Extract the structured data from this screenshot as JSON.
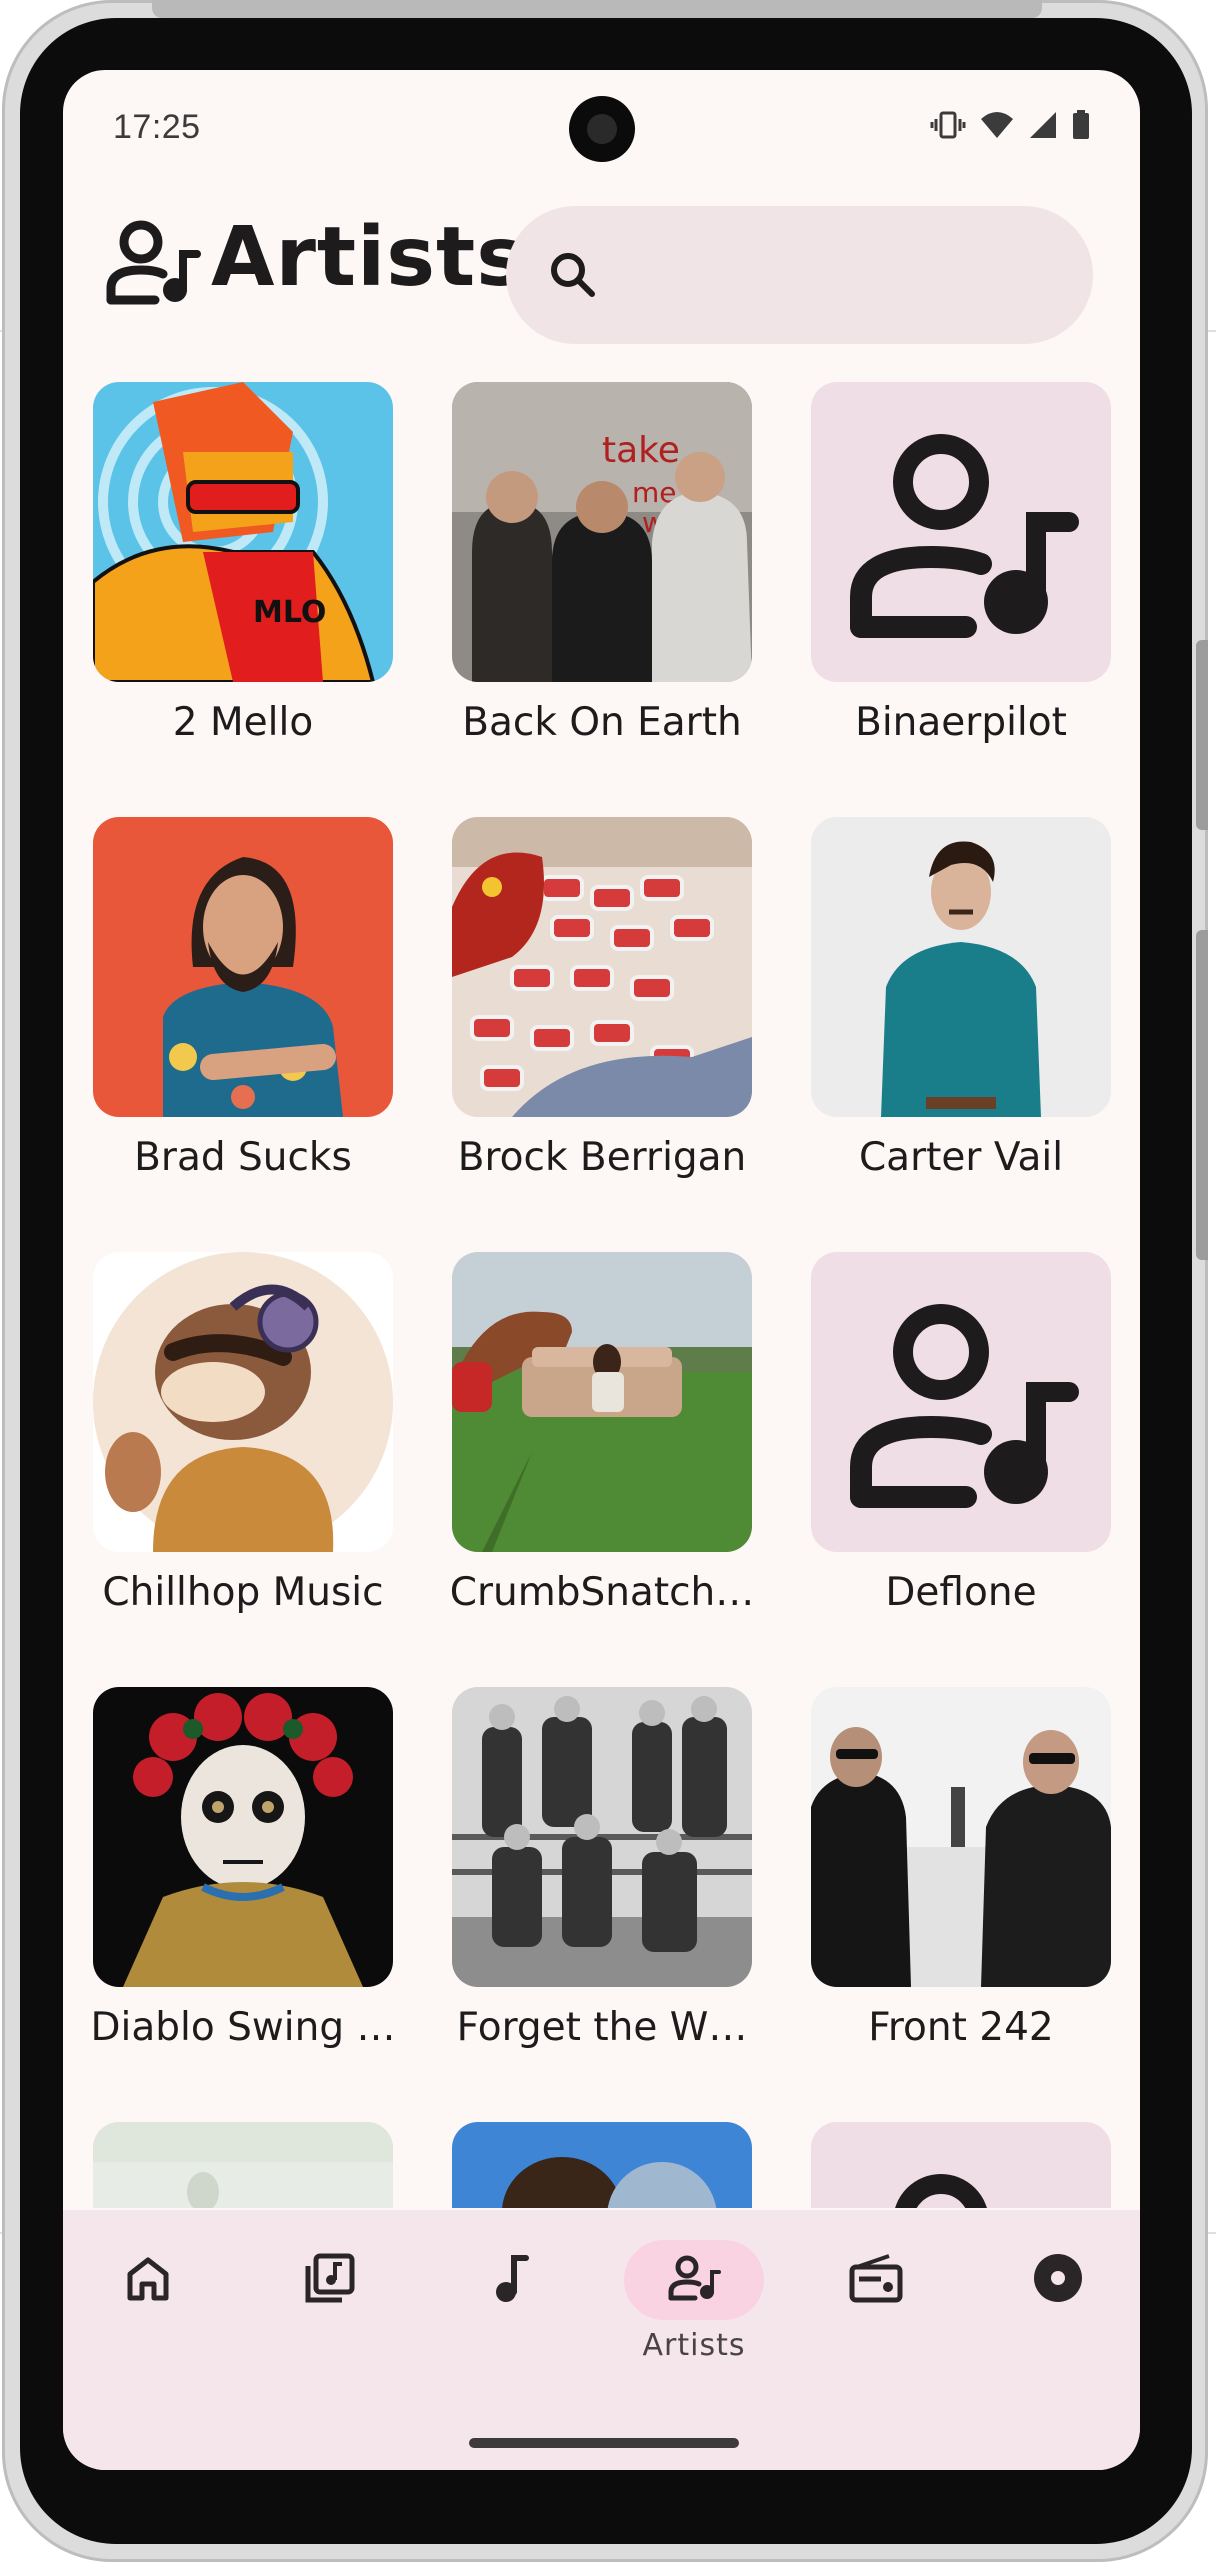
{
  "status_bar": {
    "time": "17:25",
    "icons": [
      "vibrate-icon",
      "wifi-icon",
      "signal-icon",
      "battery-icon"
    ]
  },
  "header": {
    "title": "Artists",
    "title_icon": "artists-icon",
    "search": {
      "placeholder": "",
      "value": "",
      "icon": "search-icon"
    }
  },
  "artists": [
    {
      "name": "2 Mello",
      "image": "illustrated-avatar-orange-hair-headphones"
    },
    {
      "name": "Back On Earth",
      "image": "band-photo-three-men"
    },
    {
      "name": "Binaerpilot",
      "image": "placeholder-artist-icon"
    },
    {
      "name": "Brad Sucks",
      "image": "man-long-hair-floral-shirt"
    },
    {
      "name": "Brock Berrigan",
      "image": "rooster-mask-beer-cans"
    },
    {
      "name": "Carter Vail",
      "image": "man-teal-shirt-white-bg"
    },
    {
      "name": "Chillhop Music",
      "image": "illustrated-raccoon-headphones"
    },
    {
      "name": "CrumbSnatch…",
      "image": "person-on-couch-in-field-horse"
    },
    {
      "name": "Deflone",
      "image": "placeholder-artist-icon"
    },
    {
      "name": "Diablo Swing …",
      "image": "sugar-skull-woman-roses"
    },
    {
      "name": "Forget the W…",
      "image": "band-black-white-fence"
    },
    {
      "name": "Front 242",
      "image": "two-men-sunglasses-beach"
    },
    {
      "name": "",
      "image": "pale-photo"
    },
    {
      "name": "",
      "image": "blue-sky-portrait"
    },
    {
      "name": "",
      "image": "placeholder-artist-icon"
    }
  ],
  "bottom_nav": {
    "items": [
      {
        "icon": "home-icon",
        "label": ""
      },
      {
        "icon": "album-icon",
        "label": ""
      },
      {
        "icon": "music-note-icon",
        "label": ""
      },
      {
        "icon": "artists-icon",
        "label": "Artists",
        "active": true
      },
      {
        "icon": "radio-icon",
        "label": ""
      },
      {
        "icon": "disc-icon",
        "label": ""
      }
    ]
  },
  "colors": {
    "background": "#fdf7f6",
    "search_bg": "#f0e4e6",
    "placeholder_bg": "#efdee5",
    "nav_bg": "#f5e6ec",
    "nav_active_pill": "#f9d3e2",
    "text": "#1e1b1d"
  }
}
